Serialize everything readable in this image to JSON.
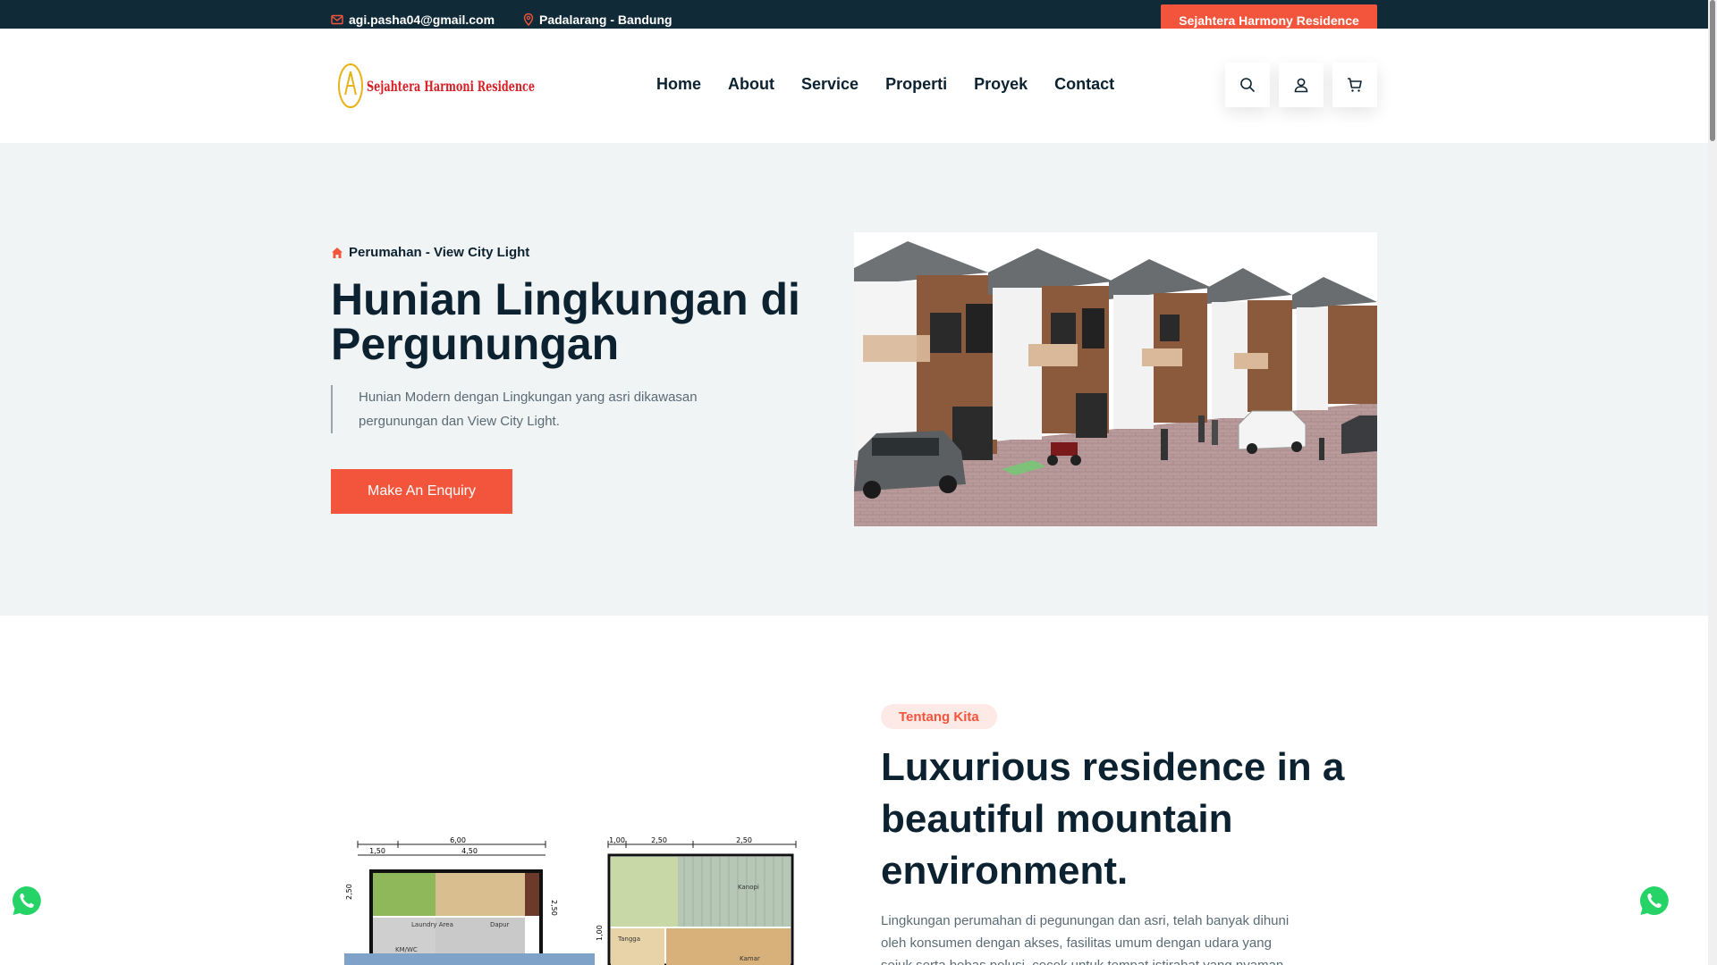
{
  "topbar": {
    "email": "agi.pasha04@gmail.com",
    "location": "Padalarang - Bandung",
    "brand_button": "Sejahtera Harmony Residence"
  },
  "header": {
    "logo_text": "Sejahtera Harmoni Residence",
    "nav": [
      "Home",
      "About",
      "Service",
      "Properti",
      "Proyek",
      "Contact"
    ],
    "icons": [
      "search-icon",
      "user-icon",
      "cart-icon"
    ]
  },
  "hero": {
    "tag": "Perumahan - View City Light",
    "title": "Hunian Lingkungan di Pergunungan",
    "description": "Hunian Modern dengan Lingkungan yang asri dikawasan pergunungan dan View City Light.",
    "cta": "Make An Enquiry"
  },
  "about": {
    "tag": "Tentang Kita",
    "title": "Luxurious residence in a beautiful mountain environment.",
    "text": "Lingkungan perumahan di pegunungan dan asri, telah banyak dihuni oleh konsumen dengan akses, fasilitas umum dengan udara yang sejuk serta bebas polusi, cocok untuk tempat istirahat yang nyaman"
  },
  "floorplan": {
    "dimensions": [
      "6,00",
      "1,50",
      "4,50",
      "2,50",
      "2,50",
      "1,00",
      "2,50",
      "2,50",
      "1,00"
    ],
    "rooms": [
      "Laundry Area",
      "Dapur",
      "KM/WC",
      "Kanopi",
      "Tangga",
      "Kamar"
    ]
  },
  "colors": {
    "accent": "#f3553c",
    "dark": "#102a38",
    "hero_bg": "#f1f4f5"
  }
}
